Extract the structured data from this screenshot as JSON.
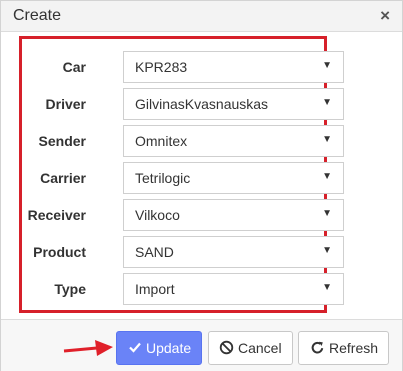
{
  "dialog": {
    "title": "Create",
    "close_glyph": "×"
  },
  "form": {
    "fields": [
      {
        "label": "Car",
        "value": "KPR283"
      },
      {
        "label": "Driver",
        "value": "GilvinasKvasnauskas"
      },
      {
        "label": "Sender",
        "value": "Omnitex"
      },
      {
        "label": "Carrier",
        "value": "Tetrilogic"
      },
      {
        "label": "Receiver",
        "value": "Vilkoco"
      },
      {
        "label": "Product",
        "value": "SAND"
      },
      {
        "label": "Type",
        "value": "Import"
      }
    ],
    "dropdown_glyph": "▼",
    "highlight_color": "#d6202a"
  },
  "footer": {
    "update_label": "Update",
    "update_icon": "check-icon",
    "cancel_label": "Cancel",
    "cancel_icon": "ban-icon",
    "refresh_label": "Refresh",
    "refresh_icon": "refresh-icon",
    "accent_color": "#6a83f7"
  }
}
